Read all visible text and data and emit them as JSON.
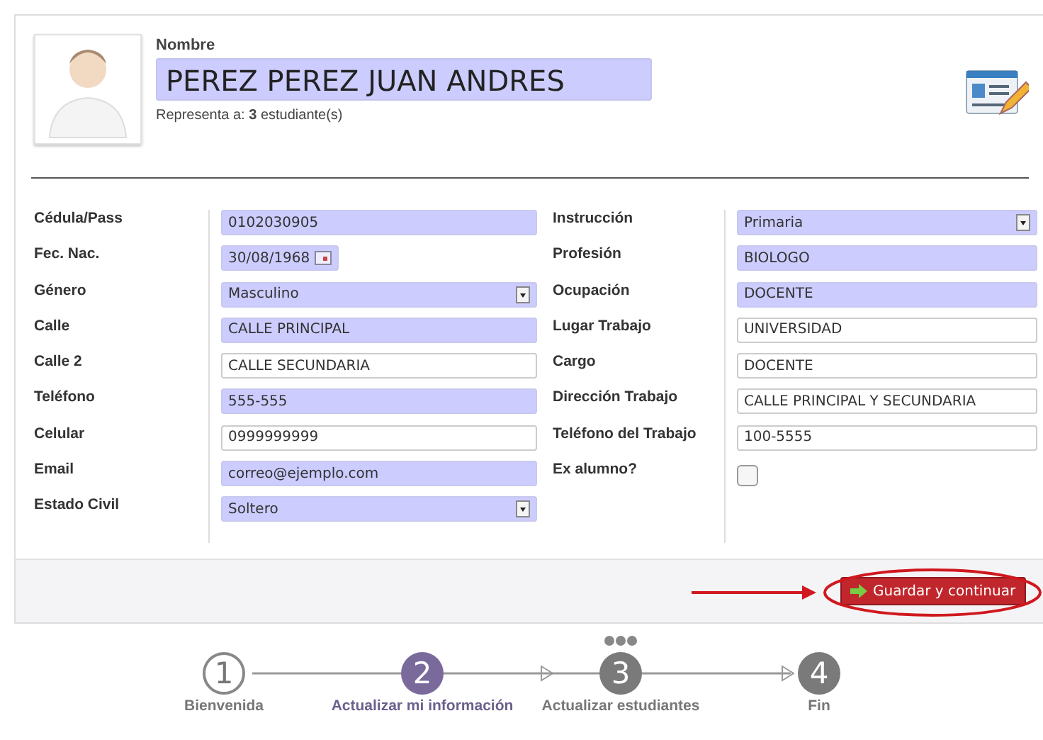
{
  "profile": {
    "name_label": "Nombre",
    "name": "PEREZ PEREZ JUAN ANDRES",
    "represents_prefix": "Representa a:",
    "represents_count": "3",
    "represents_suffix": "estudiante(s)"
  },
  "left_fields": [
    {
      "label": "Cédula/Pass",
      "kind": "text",
      "value": "0102030905",
      "required": true
    },
    {
      "label": "Fec. Nac.",
      "kind": "date",
      "value": "30/08/1968",
      "required": true
    },
    {
      "label": "Género",
      "kind": "select",
      "value": "Masculino",
      "required": true
    },
    {
      "label": "Calle",
      "kind": "text",
      "value": "CALLE PRINCIPAL",
      "required": true
    },
    {
      "label": "Calle 2",
      "kind": "text",
      "value": "CALLE SECUNDARIA",
      "required": false
    },
    {
      "label": "Teléfono",
      "kind": "text",
      "value": "555-555",
      "required": true
    },
    {
      "label": "Celular",
      "kind": "text",
      "value": "0999999999",
      "required": false
    },
    {
      "label": "Email",
      "kind": "text",
      "value": "correo@ejemplo.com",
      "required": true
    },
    {
      "label": "Estado Civil",
      "kind": "select",
      "value": "Soltero",
      "required": true
    }
  ],
  "right_fields": [
    {
      "label": "Instrucción",
      "kind": "select",
      "value": "Primaria",
      "required": true
    },
    {
      "label": "Profesión",
      "kind": "text",
      "value": "BIOLOGO",
      "required": true
    },
    {
      "label": "Ocupación",
      "kind": "text",
      "value": "DOCENTE",
      "required": true
    },
    {
      "label": "Lugar Trabajo",
      "kind": "text",
      "value": "UNIVERSIDAD",
      "required": false
    },
    {
      "label": "Cargo",
      "kind": "text",
      "value": "DOCENTE",
      "required": false
    },
    {
      "label": "Dirección Trabajo",
      "kind": "text",
      "value": "CALLE PRINCIPAL Y SECUNDARIA",
      "required": false
    },
    {
      "label": "Teléfono del Trabajo",
      "kind": "text",
      "value": "100-5555",
      "required": false
    },
    {
      "label": "Ex alumno?",
      "kind": "checkbox",
      "checked": false
    }
  ],
  "save_button": "Guardar y continuar",
  "steps": [
    {
      "number": "1",
      "label": "Bienvenida",
      "done": true,
      "current": false,
      "busy": false
    },
    {
      "number": "2",
      "label": "Actualizar mi información",
      "done": false,
      "current": true,
      "busy": false
    },
    {
      "number": "3",
      "label": "Actualizar estudiantes",
      "done": false,
      "current": false,
      "busy": true
    },
    {
      "number": "4",
      "label": "Fin",
      "done": false,
      "current": false,
      "busy": false
    }
  ]
}
